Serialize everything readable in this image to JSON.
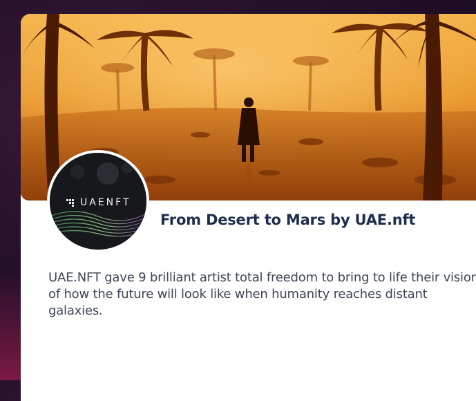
{
  "collection": {
    "title": "From Desert to Mars by UAE.nft",
    "description": "UAE.NFT gave 9 brilliant artist total freedom to bring to life their vision of how the future will look like when humanity reaches distant galaxies.",
    "avatar_logo_text": "UAENFT"
  },
  "colors": {
    "title": "#1f2d4d",
    "description": "#3d4554",
    "banner_sky": "#e89a2c",
    "page_background": "#24102a"
  }
}
